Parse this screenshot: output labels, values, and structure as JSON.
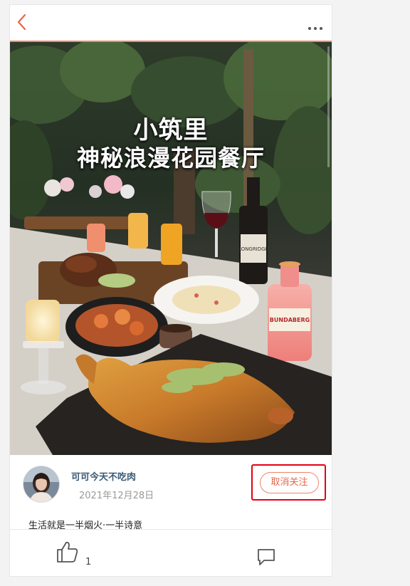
{
  "header": {
    "back_icon": "chevron-left-icon",
    "more_icon": "more-horizontal-icon"
  },
  "photo": {
    "title_line1": "小筑里",
    "title_line2": "神秘浪漫花园餐厅",
    "bottle_label": "LONGRIDGE",
    "drink_label": "BUNDABERG"
  },
  "author": {
    "name": "可可今天不吃肉",
    "date": "2021年12月28日",
    "unfollow_label": "取消关注"
  },
  "post": {
    "caption": "生活就是一半烟火·一半诗意"
  },
  "actions": {
    "like_icon": "thumbs-up-icon",
    "like_count": "1",
    "comment_icon": "comment-icon"
  },
  "colors": {
    "accent": "#e8664a",
    "highlight_box": "#e60012",
    "author_name": "#3b5a75"
  }
}
